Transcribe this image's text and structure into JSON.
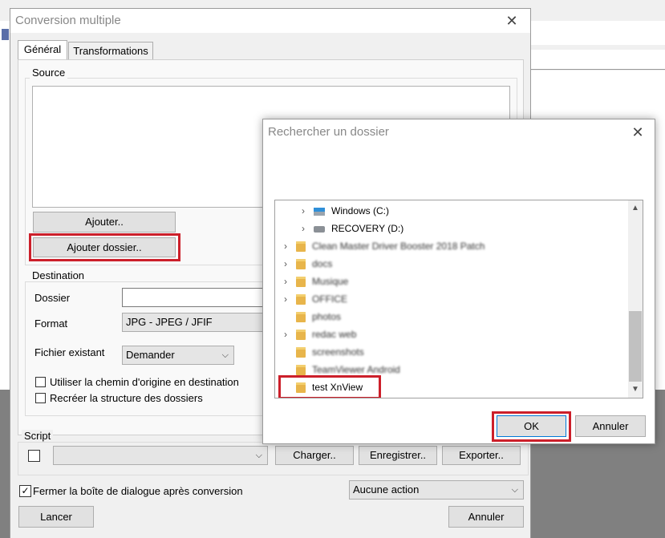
{
  "main_dialog": {
    "title": "Conversion multiple",
    "tabs": [
      {
        "label": "Général"
      },
      {
        "label": "Transformations"
      }
    ],
    "source": {
      "label": "Source",
      "add_button": "Ajouter..",
      "add_folder_button": "Ajouter dossier.."
    },
    "destination": {
      "label": "Destination",
      "folder_label": "Dossier",
      "format_label": "Format",
      "format_value": "JPG - JPEG / JFIF",
      "existing_label": "Fichier existant",
      "existing_value": "Demander",
      "use_original_path": "Utiliser la chemin d'origine en destination",
      "recreate_structure": "Recréer la structure des dossiers"
    },
    "script": {
      "label": "Script",
      "load_button": "Charger..",
      "save_button": "Enregistrer..",
      "export_button": "Exporter.."
    },
    "close_after": "Fermer la boîte de dialogue après conversion",
    "after_action": "Aucune action",
    "run_button": "Lancer",
    "cancel_button": "Annuler"
  },
  "folder_dialog": {
    "title": "Rechercher un dossier",
    "tree": [
      {
        "label": "Windows (C:)",
        "expander": "›",
        "icon": "windows-drive-icon"
      },
      {
        "label": "RECOVERY (D:)",
        "expander": "›",
        "icon": "drive-icon"
      },
      {
        "label": "Clean Master Driver Booster 2018 Patch",
        "expander": "›",
        "icon": "folder-icon",
        "blurred": true
      },
      {
        "label": "docs",
        "expander": "›",
        "icon": "folder-icon",
        "blurred": true
      },
      {
        "label": "Musique",
        "expander": "›",
        "icon": "folder-icon",
        "blurred": true
      },
      {
        "label": "OFFICE",
        "expander": "›",
        "icon": "folder-icon",
        "blurred": true
      },
      {
        "label": "photos",
        "expander": "",
        "icon": "folder-icon",
        "blurred": true
      },
      {
        "label": "redac web",
        "expander": "›",
        "icon": "folder-icon",
        "blurred": true
      },
      {
        "label": "screenshots",
        "expander": "",
        "icon": "folder-icon",
        "blurred": true
      },
      {
        "label": "TeamViewer Android",
        "expander": "",
        "icon": "folder-icon",
        "blurred": true
      },
      {
        "label": "test XnView",
        "expander": "",
        "icon": "folder-icon",
        "selected": true
      }
    ],
    "ok_button": "OK",
    "cancel_button": "Annuler"
  },
  "colors": {
    "highlight": "#cc1f2a",
    "folder": "#e8b54b"
  }
}
